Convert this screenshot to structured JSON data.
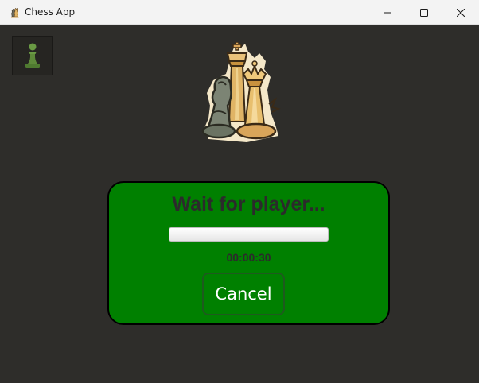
{
  "window": {
    "title": "Chess App",
    "app_icon": "chess-pieces-icon",
    "controls": [
      "minimize-icon",
      "maximize-icon",
      "close-icon"
    ]
  },
  "toolbar": {
    "pawn_icon": "pawn-icon"
  },
  "logo": {
    "icon": "chess-pieces-logo"
  },
  "wait_dialog": {
    "title": "Wait for player...",
    "progress_fraction": 0,
    "timer": "00:00:30",
    "cancel_label": "Cancel"
  },
  "colors": {
    "background": "#2e2d2a",
    "panel": "#008000",
    "panel_border": "#000000",
    "pawn": "#5e8a3a"
  }
}
